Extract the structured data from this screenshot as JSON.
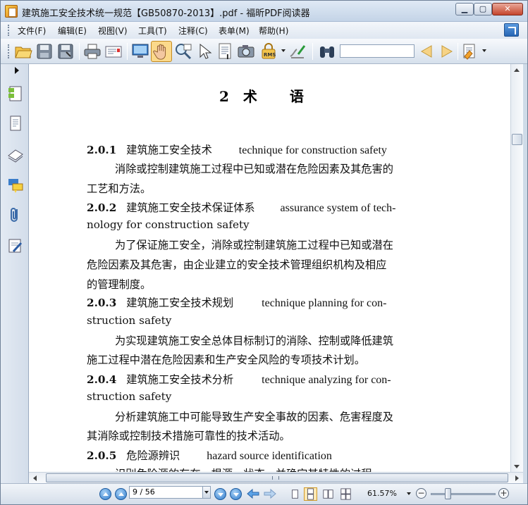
{
  "window": {
    "title": "建筑施工安全技术统一规范【GB50870-2013】.pdf - 福昕PDF阅读器",
    "min_label": "▁",
    "max_label": "▢",
    "close_label": "✕"
  },
  "menu": {
    "items": [
      "文件(F)",
      "编辑(E)",
      "视图(V)",
      "工具(T)",
      "注释(C)",
      "表单(M)",
      "帮助(H)"
    ]
  },
  "toolbar": {
    "search_value": "",
    "icons": [
      "open-folder-icon",
      "save-icon",
      "save-as-icon",
      "print-icon",
      "email-icon",
      "monitor-icon",
      "hand-tool-icon",
      "zoom-glass-icon",
      "select-arrow-icon",
      "text-select-icon",
      "snapshot-icon",
      "rms-lock-icon",
      "sign-icon",
      "binoculars-icon",
      "find-previous-icon",
      "find-next-icon",
      "highlight-icon"
    ],
    "rms_label": "RMS"
  },
  "status": {
    "page_value": "9 / 56",
    "zoom": "61.57%",
    "zoom_minus": "−",
    "zoom_plus": "+"
  },
  "document": {
    "heading_num": "2",
    "heading_w1": "术",
    "heading_w2": "语",
    "lines": [
      {
        "num": "2.0.1",
        "term": "建筑施工安全技术",
        "en": "technique for construction safety"
      },
      {
        "text": "消除或控制建筑施工过程中已知或潜在危险因素及其危害的"
      },
      {
        "text": "工艺和方法。"
      },
      {
        "num": "2.0.2",
        "term": "建筑施工安全技术保证体系",
        "en": "assurance system of tech-"
      },
      {
        "text_en": "nology for construction safety"
      },
      {
        "text": "为了保证施工安全，消除或控制建筑施工过程中已知或潜在"
      },
      {
        "text": "危险因素及其危害，由企业建立的安全技术管理组织机构及相应"
      },
      {
        "text": "的管理制度。"
      },
      {
        "num": "2.0.3",
        "term": "建筑施工安全技术规划",
        "en": "technique planning for con-"
      },
      {
        "text_en": "struction safety"
      },
      {
        "text": "为实现建筑施工安全总体目标制订的消除、控制或降低建筑"
      },
      {
        "text": "施工过程中潜在危险因素和生产安全风险的专项技术计划。"
      },
      {
        "num": "2.0.4",
        "term": "建筑施工安全技术分析",
        "en": "technique analyzing for con-"
      },
      {
        "text_en": "struction safety"
      },
      {
        "text": "分析建筑施工中可能导致生产安全事故的因素、危害程度及"
      },
      {
        "text": "其消除或控制技术措施可靠性的技术活动。"
      },
      {
        "num": "2.0.5",
        "term": "危险源辨识",
        "en": "hazard source identification"
      },
      {
        "text": "识别危险源的存在、根源、状态，并确定其特性的过程。"
      }
    ]
  }
}
